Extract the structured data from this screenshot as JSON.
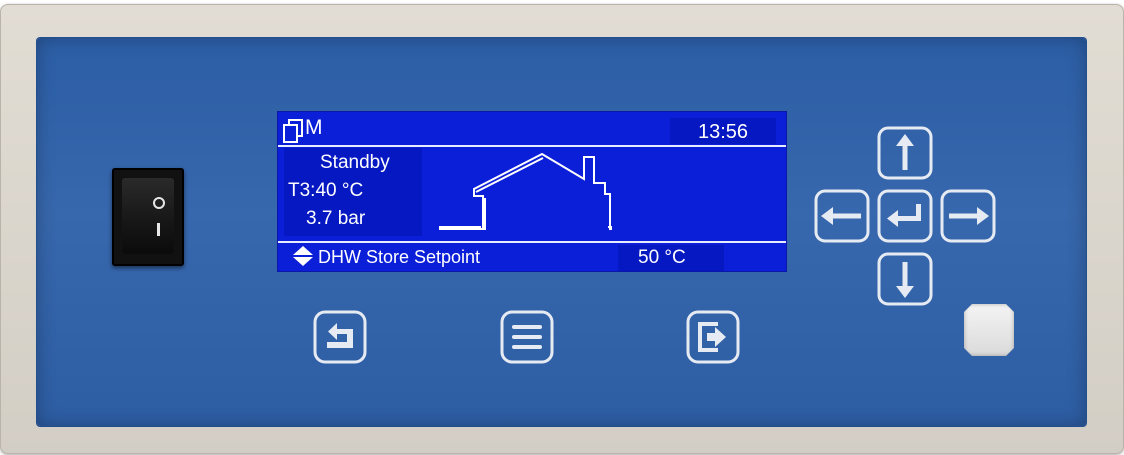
{
  "display": {
    "mode_label": "M",
    "time": "13:56",
    "status": "Standby",
    "t3_reading": "T3:40 °C",
    "pressure": "3.7 bar",
    "parameter_name": "DHW Store Setpoint",
    "parameter_value": "50 °C"
  },
  "power_switch": {
    "on_mark": "O",
    "off_mark": "I"
  },
  "soft_keys": [
    "back-icon",
    "menu-icon",
    "exit-icon"
  ],
  "nav_keys": [
    "arrow-up-icon",
    "arrow-left-icon",
    "enter-icon",
    "arrow-right-icon",
    "arrow-down-icon"
  ],
  "colors": {
    "panel": "#2f5fa5",
    "lcd_background": "#0b1ed8",
    "bezel": "#dcd7ce",
    "key_outline": "#e6ebf3"
  }
}
